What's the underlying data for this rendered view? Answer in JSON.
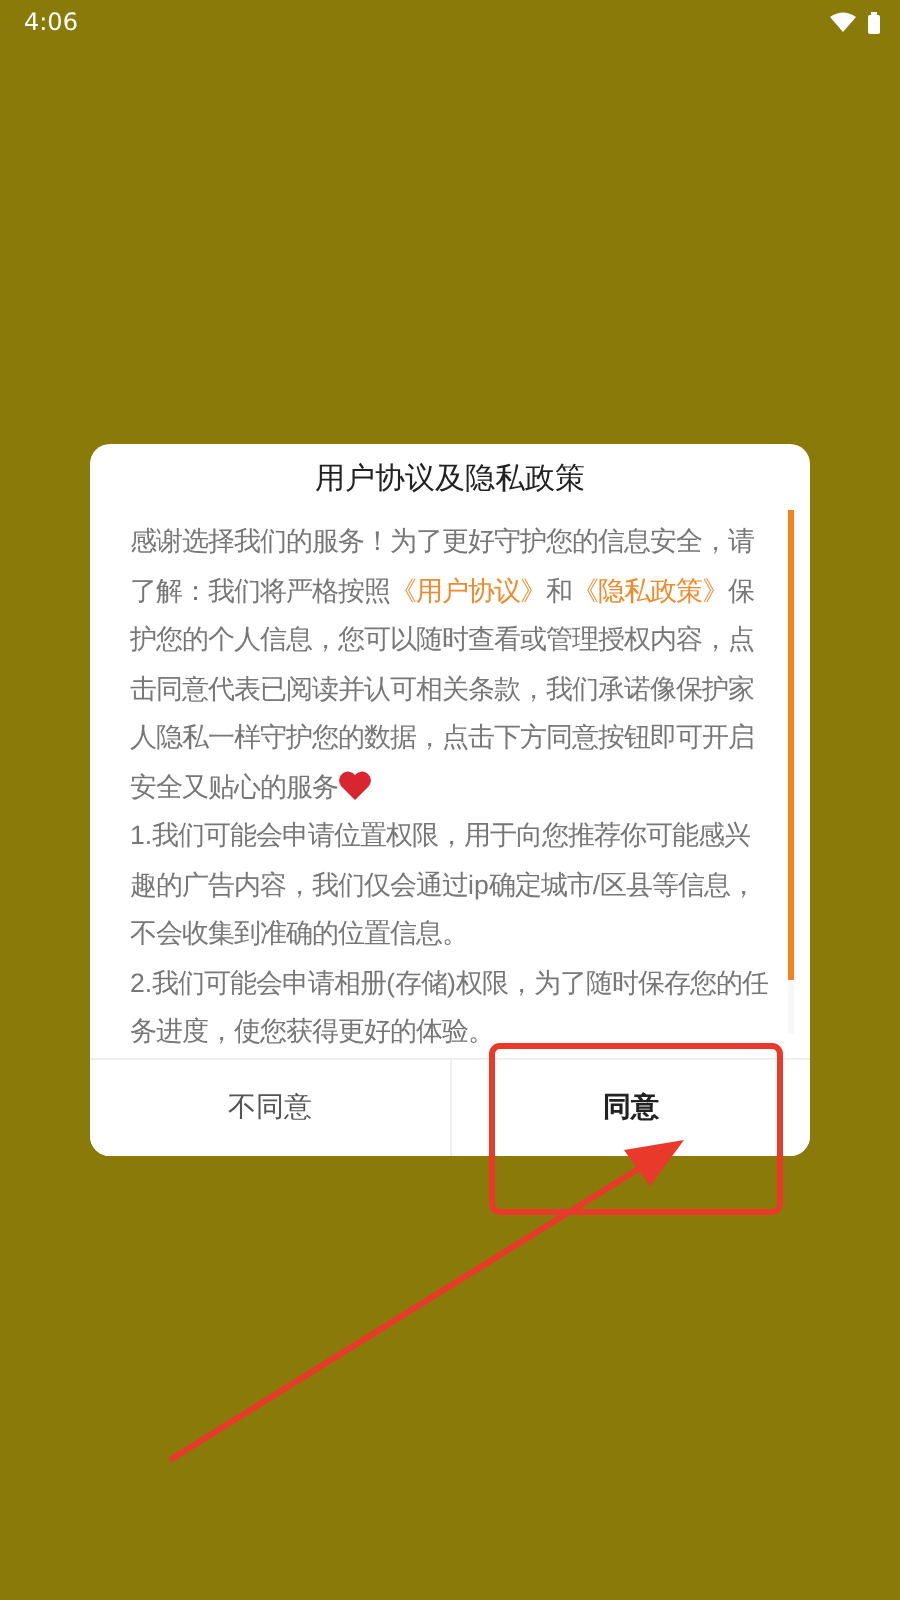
{
  "status_bar": {
    "time": "4:06"
  },
  "dialog": {
    "title": "用户协议及隐私政策",
    "paragraphs": [
      {
        "segments": [
          {
            "text": "感谢选择我们的服务！为了更好守护您的信息安全，请了解：我们将严格按照",
            "kind": "plain"
          },
          {
            "text": "《用户协议》",
            "kind": "link"
          },
          {
            "text": "和",
            "kind": "plain"
          },
          {
            "text": "《隐私政策》",
            "kind": "link"
          },
          {
            "text": "保护您的个人信息，您可以随时查看或管理授权内容，点击同意代表已阅读并认可相关条款，我们承诺像保护家人隐私一样守护您的数据，点击下方同意按钮即可开启安全又贴心的服务",
            "kind": "plain"
          },
          {
            "kind": "heart"
          }
        ]
      },
      {
        "segments": [
          {
            "text": "1.我们可能会申请位置权限，用于向您推荐你可能感兴趣的广告内容，我们仅会通过ip确定城市/区县等信息，不会收集到准确的位置信息。",
            "kind": "plain"
          }
        ]
      },
      {
        "segments": [
          {
            "text": "2.我们可能会申请相册(存储)权限，为了随时保存您的任务进度，使您获得更好的体验。",
            "kind": "plain"
          }
        ]
      }
    ],
    "buttons": [
      {
        "label": "不同意",
        "primary": false
      },
      {
        "label": "同意",
        "primary": true
      }
    ]
  },
  "annotation": {
    "kind": "box-and-arrow"
  }
}
